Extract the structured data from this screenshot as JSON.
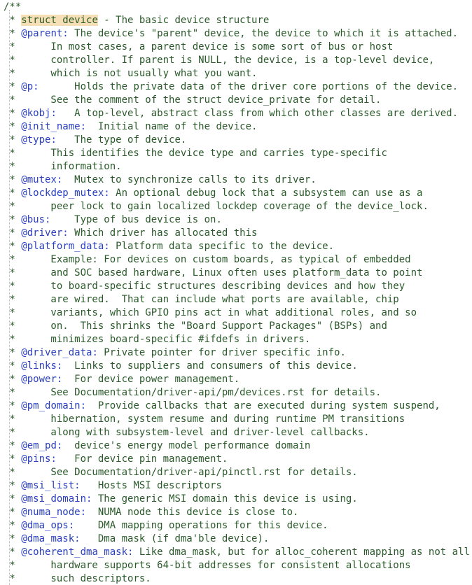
{
  "colors": {
    "comment_text": "#2a5a2a",
    "doc_tag": "#2a3fbf",
    "highlight_background": "#f6dfb5",
    "background": "#ffffff"
  },
  "lines": [
    {
      "text": "/**"
    },
    {
      "prefix": " * ",
      "highlight": "struct device",
      "text": " - The basic device structure"
    },
    {
      "prefix": " * ",
      "tag": "@parent:",
      "text": " The device's \"parent\" device, the device to which it is attached."
    },
    {
      "text": " *      In most cases, a parent device is some sort of bus or host"
    },
    {
      "text": " *      controller. If parent is NULL, the device, is a top-level device,"
    },
    {
      "text": " *      which is not usually what you want."
    },
    {
      "prefix": " * ",
      "tag": "@p:",
      "text": "      Holds the private data of the driver core portions of the device."
    },
    {
      "text": " *      See the comment of the struct device_private for detail."
    },
    {
      "prefix": " * ",
      "tag": "@kobj:",
      "text": "   A top-level, abstract class from which other classes are derived."
    },
    {
      "prefix": " * ",
      "tag": "@init_name:",
      "text": "  Initial name of the device."
    },
    {
      "prefix": " * ",
      "tag": "@type:",
      "text": "   The type of device."
    },
    {
      "text": " *      This identifies the device type and carries type-specific"
    },
    {
      "text": " *      information."
    },
    {
      "prefix": " * ",
      "tag": "@mutex:",
      "text": "  Mutex to synchronize calls to its driver."
    },
    {
      "prefix": " * ",
      "tag": "@lockdep_mutex:",
      "text": " An optional debug lock that a subsystem can use as a"
    },
    {
      "text": " *      peer lock to gain localized lockdep coverage of the device_lock."
    },
    {
      "prefix": " * ",
      "tag": "@bus:",
      "text": "    Type of bus device is on."
    },
    {
      "prefix": " * ",
      "tag": "@driver:",
      "text": " Which driver has allocated this"
    },
    {
      "prefix": " * ",
      "tag": "@platform_data:",
      "text": " Platform data specific to the device."
    },
    {
      "text": " *      Example: For devices on custom boards, as typical of embedded"
    },
    {
      "text": " *      and SOC based hardware, Linux often uses platform_data to point"
    },
    {
      "text": " *      to board-specific structures describing devices and how they"
    },
    {
      "text": " *      are wired.  That can include what ports are available, chip"
    },
    {
      "text": " *      variants, which GPIO pins act in what additional roles, and so"
    },
    {
      "text": " *      on.  This shrinks the \"Board Support Packages\" (BSPs) and"
    },
    {
      "text": " *      minimizes board-specific #ifdefs in drivers."
    },
    {
      "prefix": " * ",
      "tag": "@driver_data:",
      "text": " Private pointer for driver specific info."
    },
    {
      "prefix": " * ",
      "tag": "@links:",
      "text": "  Links to suppliers and consumers of this device."
    },
    {
      "prefix": " * ",
      "tag": "@power:",
      "text": "  For device power management."
    },
    {
      "text": " *      See Documentation/driver-api/pm/devices.rst for details."
    },
    {
      "prefix": " * ",
      "tag": "@pm_domain:",
      "text": "  Provide callbacks that are executed during system suspend,"
    },
    {
      "text": " *      hibernation, system resume and during runtime PM transitions"
    },
    {
      "text": " *      along with subsystem-level and driver-level callbacks."
    },
    {
      "prefix": " * ",
      "tag": "@em_pd:",
      "text": "  device's energy model performance domain"
    },
    {
      "prefix": " * ",
      "tag": "@pins:",
      "text": "   For device pin management."
    },
    {
      "text": " *      See Documentation/driver-api/pinctl.rst for details."
    },
    {
      "prefix": " * ",
      "tag": "@msi_list:",
      "text": "   Hosts MSI descriptors"
    },
    {
      "prefix": " * ",
      "tag": "@msi_domain:",
      "text": " The generic MSI domain this device is using."
    },
    {
      "prefix": " * ",
      "tag": "@numa_node:",
      "text": "  NUMA node this device is close to."
    },
    {
      "prefix": " * ",
      "tag": "@dma_ops:",
      "text": "    DMA mapping operations for this device."
    },
    {
      "prefix": " * ",
      "tag": "@dma_mask:",
      "text": "   Dma mask (if dma'ble device)."
    },
    {
      "prefix": " * ",
      "tag": "@coherent_dma_mask:",
      "text": " Like dma_mask, but for alloc_coherent mapping as not all"
    },
    {
      "text": " *      hardware supports 64-bit addresses for consistent allocations"
    },
    {
      "text": " *      such descriptors."
    }
  ]
}
